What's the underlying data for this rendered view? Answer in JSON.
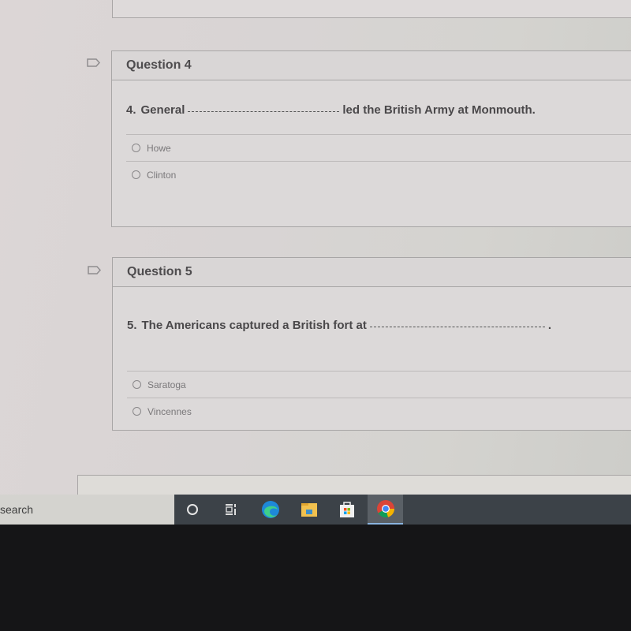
{
  "questions": [
    {
      "header": "Question 4",
      "number": "4.",
      "text_before": "General",
      "text_after": "led the British Army at Monmouth.",
      "options": [
        {
          "label": "Howe",
          "selected": false
        },
        {
          "label": "Clinton",
          "selected": false
        }
      ]
    },
    {
      "header": "Question 5",
      "number": "5.",
      "text_before": "The Americans captured a British fort at",
      "text_after": ".",
      "options": [
        {
          "label": "Saratoga",
          "selected": false
        },
        {
          "label": "Vincennes",
          "selected": false
        }
      ]
    }
  ],
  "taskbar": {
    "search_label": "search",
    "icons": [
      "cortana-icon",
      "task-view-icon",
      "edge-icon",
      "file-explorer-icon",
      "store-icon",
      "chrome-icon"
    ],
    "active_icon": "chrome-icon"
  }
}
